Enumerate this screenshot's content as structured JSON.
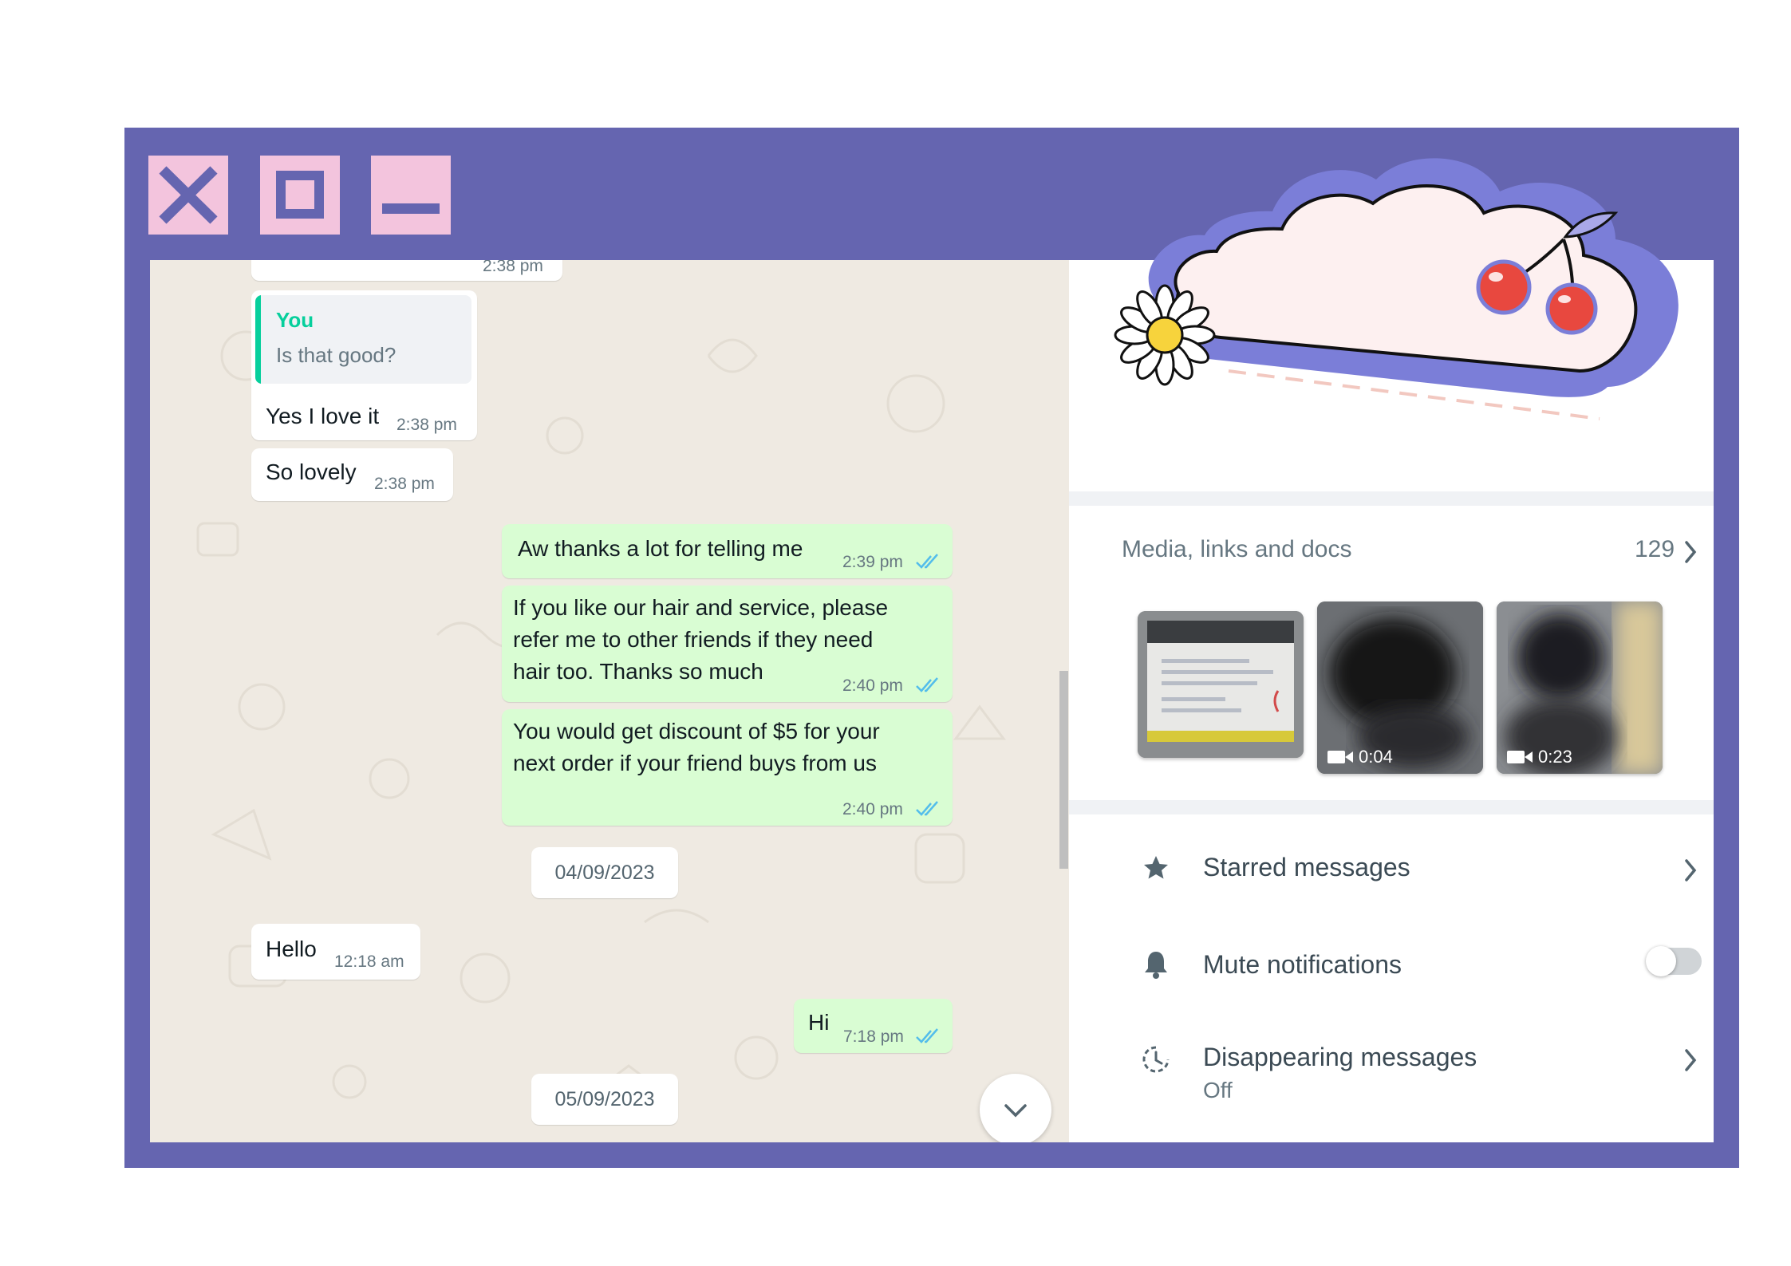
{
  "window": {
    "controls": [
      "close",
      "maximize",
      "minimize"
    ],
    "frame_color": "#6565b0",
    "control_color": "#f3c4dd"
  },
  "chat": {
    "partial_top_time": "2:38 pm",
    "messages": [
      {
        "direction": "incoming",
        "quote_author": "You",
        "quote_text": "Is that good?",
        "text": "Yes I love it",
        "time": "2:38 pm"
      },
      {
        "direction": "incoming",
        "text": "So lovely",
        "time": "2:38 pm"
      },
      {
        "direction": "outgoing",
        "text": "Aw thanks a lot for telling me",
        "time": "2:39 pm",
        "status": "read"
      },
      {
        "direction": "outgoing",
        "text": "If you like our hair and service, please\nrefer me to other friends if they need\nhair too. Thanks so much",
        "time": "2:40 pm",
        "status": "read"
      },
      {
        "direction": "outgoing",
        "text": "You would get discount of $5 for your\nnext order if your friend buys from us",
        "time": "2:40 pm",
        "status": "read"
      },
      {
        "direction": "incoming",
        "text": "Hello",
        "time": "12:18 am"
      },
      {
        "direction": "outgoing",
        "text": "Hi",
        "time": "7:18 pm",
        "status": "read"
      }
    ],
    "date_separators": [
      "04/09/2023",
      "05/09/2023"
    ],
    "colors": {
      "incoming": "#ffffff",
      "outgoing": "#d9fdd3",
      "wallpaper": "#efeae2",
      "read_tick": "#53bdeb",
      "quote_accent": "#06cf9c"
    }
  },
  "panel": {
    "media": {
      "title": "Media, links and docs",
      "count": "129",
      "thumbnails": [
        {
          "kind": "image",
          "icon": "document-photo-icon"
        },
        {
          "kind": "video",
          "duration": "0:04",
          "icon": "video-camera-icon"
        },
        {
          "kind": "video",
          "duration": "0:23",
          "icon": "video-camera-icon"
        }
      ]
    },
    "starred": {
      "label": "Starred messages",
      "icon": "star-icon"
    },
    "mute": {
      "label": "Mute notifications",
      "icon": "bell-icon",
      "enabled": false
    },
    "disappearing": {
      "label": "Disappearing messages",
      "value": "Off",
      "icon": "timer-icon"
    }
  },
  "decoration": {
    "sticker": "cloud-with-daisy-and-cherries",
    "cloud_color": "#fdf0f0",
    "outline_color": "#7b7ed8"
  }
}
